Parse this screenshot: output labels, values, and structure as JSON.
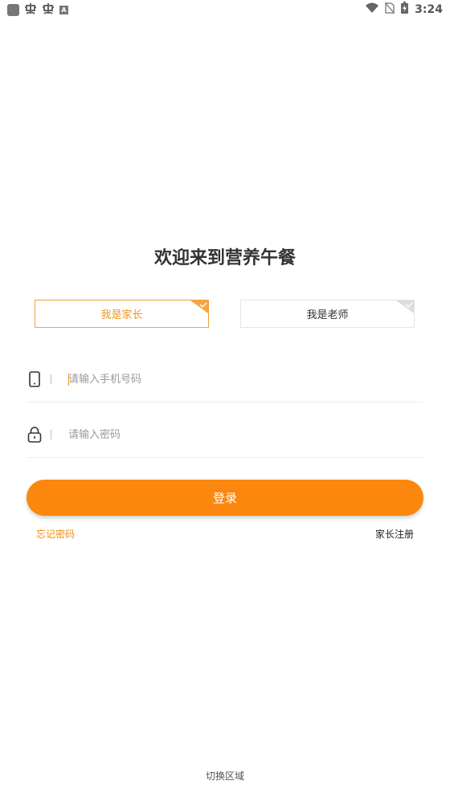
{
  "status_bar": {
    "time": "3:24",
    "left_icons": [
      "app-square-icon",
      "bug-icon",
      "bug-icon",
      "a-badge-icon"
    ],
    "right_icons": [
      "wifi-icon",
      "no-sim-icon",
      "battery-charging-icon"
    ]
  },
  "page": {
    "title": "欢迎来到营养午餐"
  },
  "roles": {
    "parent_label": "我是家长",
    "teacher_label": "我是老师",
    "selected": "parent"
  },
  "form": {
    "phone_placeholder": "请输入手机号码",
    "phone_value": "",
    "password_placeholder": "请输入密码",
    "password_value": ""
  },
  "actions": {
    "login_label": "登录",
    "forgot_label": "忘记密码",
    "register_label": "家长注册"
  },
  "footer": {
    "switch_region_label": "切换区域"
  },
  "colors": {
    "accent": "#fb870e",
    "accent_text": "#f29425",
    "border": "#e4e4e4"
  }
}
